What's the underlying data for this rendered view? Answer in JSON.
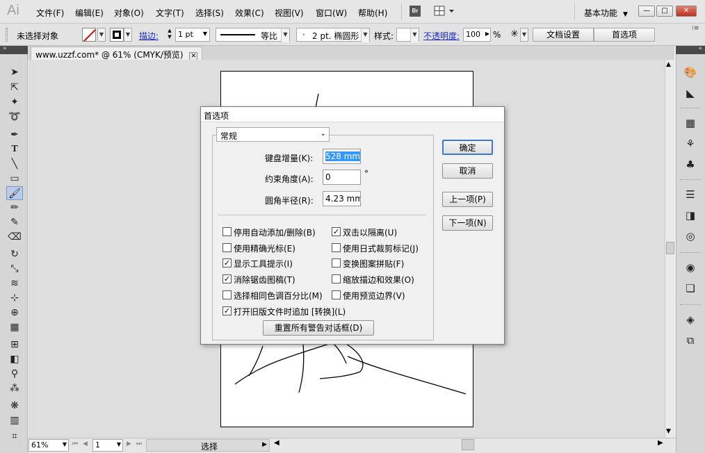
{
  "menubar": {
    "app_logo": "Ai",
    "items": [
      "文件(F)",
      "编辑(E)",
      "对象(O)",
      "文字(T)",
      "选择(S)",
      "效果(C)",
      "视图(V)",
      "窗口(W)",
      "帮助(H)"
    ],
    "bridge_label": "Br",
    "workspace_label": "基本功能",
    "win_minimize": "—",
    "win_maximize": "□",
    "win_close": "✕"
  },
  "controlbar": {
    "selection_status": "未选择对象",
    "stroke_label": "描边:",
    "stroke_weight": "1 pt",
    "line_style_label": "等比",
    "brush_label": "2 pt. 椭圆形",
    "brush_dot": "·",
    "style_label": "样式:",
    "opacity_label": "不透明度:",
    "opacity_value": "100",
    "opacity_unit": "%",
    "doc_settings_button": "文档设置",
    "preferences_button": "首选项"
  },
  "document_tab": {
    "title": "www.uzzf.com* @ 61% (CMYK/预览)",
    "close": "✕"
  },
  "statusbar": {
    "zoom": "61%",
    "page": "1",
    "status_text": "选择"
  },
  "dialog": {
    "title": "首选项",
    "category": "常规",
    "fields": [
      {
        "label": "键盘增量(K):",
        "value": "528 mm",
        "selected": true
      },
      {
        "label": "约束角度(A):",
        "value": "0",
        "unit": "°"
      },
      {
        "label": "圆角半径(R):",
        "value": "4.23 mm"
      }
    ],
    "checkboxes_left": [
      {
        "label": "停用自动添加/删除(B)",
        "checked": false
      },
      {
        "label": "使用精确光标(E)",
        "checked": false
      },
      {
        "label": "显示工具提示(I)",
        "checked": true
      },
      {
        "label": "消除锯齿图稿(T)",
        "checked": true
      },
      {
        "label": "选择相同色调百分比(M)",
        "checked": false
      },
      {
        "label": "打开旧版文件时追加 [转换](L)",
        "checked": true
      }
    ],
    "checkboxes_right": [
      {
        "label": "双击以隔离(U)",
        "checked": true
      },
      {
        "label": "使用日式裁剪标记(J)",
        "checked": false
      },
      {
        "label": "变换图案拼贴(F)",
        "checked": false
      },
      {
        "label": "缩放描边和效果(O)",
        "checked": false
      },
      {
        "label": "使用预览边界(V)",
        "checked": false
      }
    ],
    "reset_warnings_button": "重置所有警告对话框(D)",
    "ok_button": "确定",
    "cancel_button": "取消",
    "prev_button": "上一项(P)",
    "next_button": "下一项(N)",
    "checkmark": "✓"
  },
  "colors": {
    "dialog_focus": "#3b7ad8",
    "selection_highlight": "#3399ff",
    "link": "#1a2acc"
  }
}
